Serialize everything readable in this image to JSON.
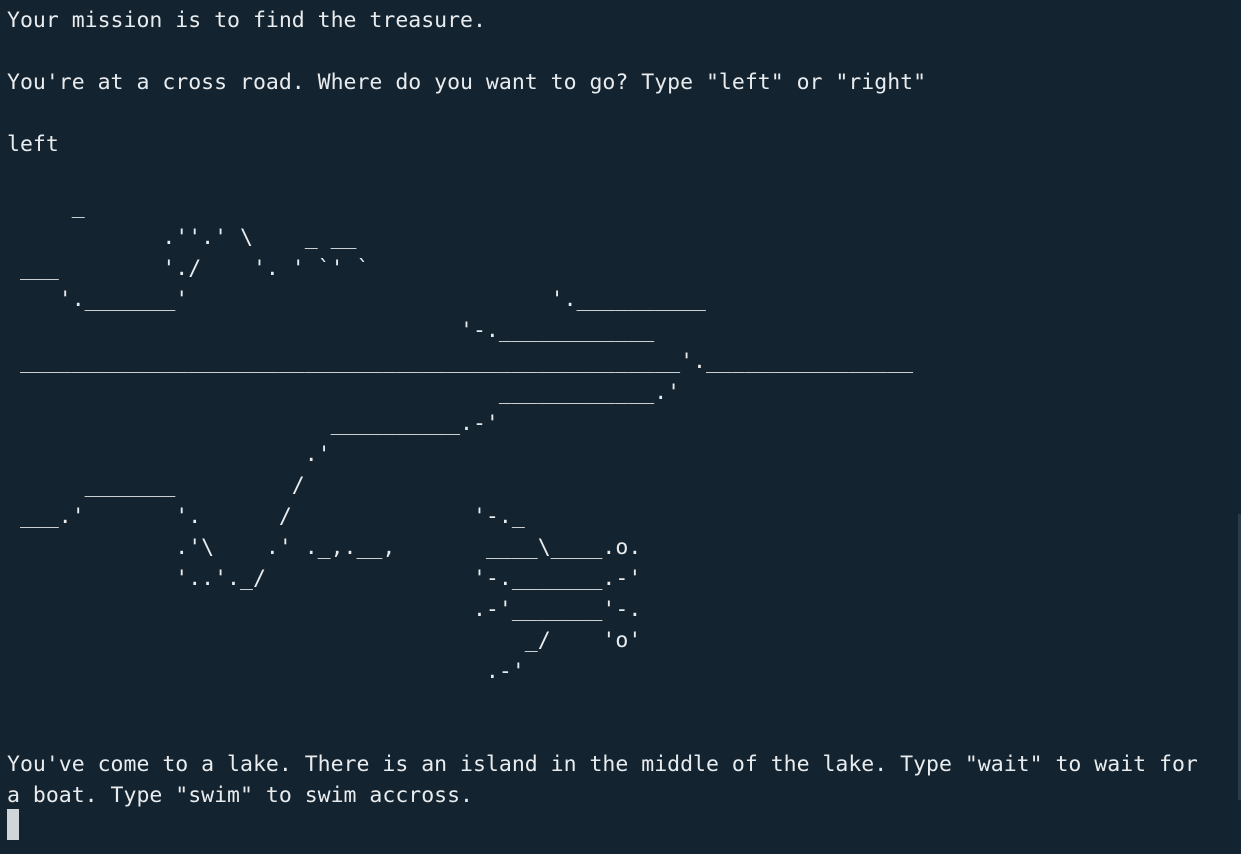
{
  "colors": {
    "background": "#13232f",
    "foreground": "#e9ecee",
    "cursor": "#d0d5d9"
  },
  "output": {
    "mission": "Your mission is to find the treasure.",
    "crossroad_prompt": "You're at a cross road. Where do you want to go? Type \"left\" or \"right\"",
    "user_input": "left",
    "lake_message": "You've come to a lake. There is an island in the middle of the lake. Type \"wait\" to wait for a boat. Type \"swim\" to swim accross."
  },
  "ascii_art": "     _\n            .''.' \\    _ __\n ___        './    '. ' `' `\n    '._______'                            '.__________\n                                   '-.____________\n ___________________________________________________'.________________\n                                      ____________.'\n                         __________.-'\n                       .'\n      _______         /\n ___.'       '.      /              '-._\n             .'\\    .' ._,.__,       ____\\____.o.\n             '..'._/                '-._______.-'\n                                    .-'_______'-.\n                                        _/    'o'\n                                     .-'"
}
